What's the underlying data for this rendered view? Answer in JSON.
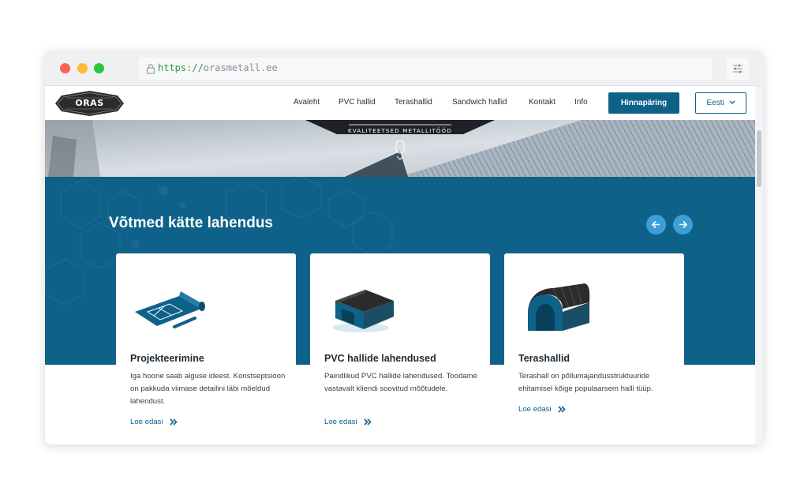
{
  "browser": {
    "url_scheme": "https://",
    "url_host": "orasmetall.ee"
  },
  "nav": {
    "logo_text": "ORAS METALL",
    "links": [
      "Avaleht",
      "PVC hallid",
      "Terashallid",
      "Sandwich hallid",
      "Kontakt",
      "Info"
    ],
    "cta_label": "Hinnapäring",
    "language_label": "Eesti"
  },
  "hero": {
    "tagline": "KVALITEETSED METALLITÖÖD"
  },
  "section": {
    "title": "Võtmed kätte lahendus"
  },
  "cards": [
    {
      "title": "Projekteerimine",
      "text": "Iga hoone saab alguse ideest. Konstseptsioon on pakkuda viimase detailini läbi mõeldud lahendust.",
      "link": "Loe edasi",
      "icon": "blueprint-icon"
    },
    {
      "title": "PVC hallide lahendused",
      "text": "Paindlikud PVC hallide lahendused. Toodame vastavalt kliendi soovitud mõõtudele.",
      "link": "Loe edasi",
      "icon": "pvc-hall-icon"
    },
    {
      "title": "Terashallid",
      "text": "Terashall on põllumajandusstruktuuride ehitamisel kõige populaarsem halli tüüp.",
      "link": "Loe edasi",
      "icon": "steel-hall-icon"
    }
  ],
  "colors": {
    "brand": "#0e6189",
    "accent": "#3c9fd8"
  }
}
